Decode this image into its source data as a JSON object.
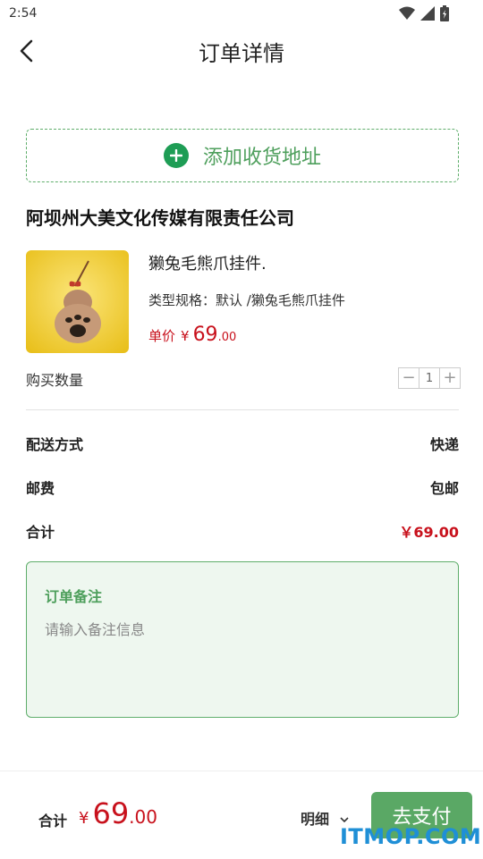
{
  "status_bar": {
    "time": "2:54",
    "icons": [
      "wifi-icon",
      "signal-icon",
      "battery-icon"
    ]
  },
  "header": {
    "title": "订单详情",
    "back_icon": "chevron-left-icon"
  },
  "address": {
    "add_label": "添加收货地址",
    "icon": "plus-circle-icon"
  },
  "shop": {
    "name": "阿坝州大美文化传媒有限责任公司"
  },
  "product": {
    "name": "獭兔毛熊爪挂件.",
    "spec": "类型规格：默认 /獭兔毛熊爪挂件",
    "price_label": "单价",
    "price_symbol": "¥",
    "price_int": "69",
    "price_dec": ".00"
  },
  "quantity": {
    "label": "购买数量",
    "minus": "−",
    "value": "1",
    "plus": "+"
  },
  "delivery": {
    "method_label": "配送方式",
    "method_value": "快递",
    "postage_label": "邮费",
    "postage_value": "包邮",
    "total_label": "合计",
    "total_value": "￥69.00"
  },
  "remark": {
    "title": "订单备注",
    "placeholder": "请输入备注信息"
  },
  "bottom_bar": {
    "total_label": "合计",
    "total_symbol": "¥",
    "total_int": "69",
    "total_dec": ".00",
    "detail_label": "明细",
    "pay_label": "去支付"
  },
  "watermark": "ITMOP.COM",
  "colors": {
    "accent_green": "#5aa865",
    "price_red": "#c8111c",
    "remark_bg": "#eef7ef"
  }
}
